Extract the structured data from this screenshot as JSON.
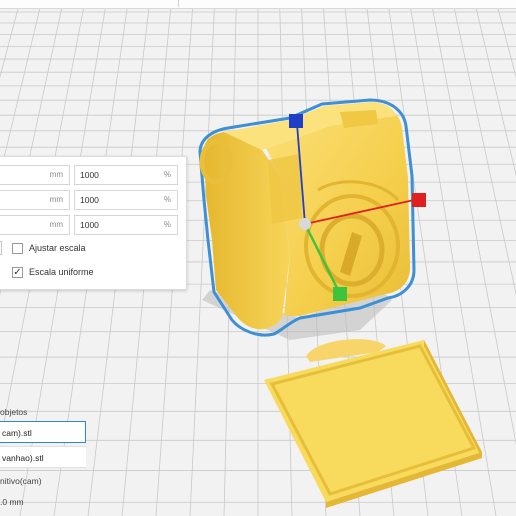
{
  "scale_panel": {
    "rows": [
      {
        "mm_unit": "mm",
        "percent_value": "1000",
        "percent_unit": "%"
      },
      {
        "mm_unit": "mm",
        "percent_value": "1000",
        "percent_unit": "%"
      },
      {
        "mm_unit": "mm",
        "percent_value": "1000",
        "percent_unit": "%"
      }
    ],
    "snap_scaling_label": "Ajustar escala",
    "snap_scaling_checked": false,
    "uniform_scaling_label": "Escala uniforme",
    "uniform_scaling_checked": true,
    "check_glyph": "✓"
  },
  "objects_panel": {
    "title": "objetos",
    "items": [
      {
        "label": "cam).stl",
        "selected": true
      },
      {
        "label": "vanhao).stl",
        "selected": false
      }
    ],
    "info_lines": [
      "nitivo(cam)",
      ".0 mm"
    ]
  },
  "colors": {
    "model_yellow": "#f7d250",
    "selection_outline": "#3d8fd6",
    "axis_x": "#e02020",
    "axis_y": "#3cc43c",
    "axis_z": "#1f3fc8",
    "build_plate": "#f2f2f2",
    "grid_line": "#c9c9c9"
  },
  "icons": [
    "move-handle-x-icon",
    "move-handle-y-icon",
    "move-handle-z-icon"
  ]
}
